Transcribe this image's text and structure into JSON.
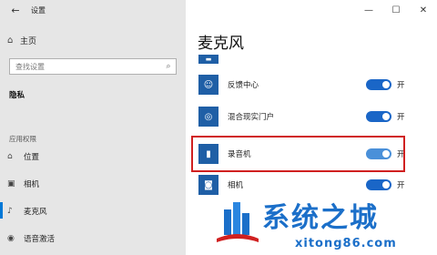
{
  "window": {
    "title": "设置",
    "back_icon": "back-arrow-icon"
  },
  "nav": {
    "home_label": "主页",
    "search_placeholder": "查找设置",
    "section_privacy": "隐私",
    "section_permissions": "应用权限",
    "items": [
      {
        "label": "位置",
        "icon": "location-icon"
      },
      {
        "label": "相机",
        "icon": "camera-icon"
      },
      {
        "label": "麦克风",
        "icon": "microphone-icon",
        "active": true
      },
      {
        "label": "语音激活",
        "icon": "voice-activation-icon"
      }
    ]
  },
  "main": {
    "title": "麦克风",
    "apps": [
      {
        "name": "反馈中心",
        "state": "开",
        "on": true
      },
      {
        "name": "混合现实门户",
        "state": "开",
        "on": true
      },
      {
        "name": "录音机",
        "state": "开",
        "on": true
      },
      {
        "name": "相机",
        "state": "开",
        "on": true
      }
    ]
  },
  "colors": {
    "accent": "#0078d7",
    "toggle_on": "#1a66c7",
    "highlight": "#d02020",
    "watermark": "#1b6fc9"
  },
  "watermark": {
    "text": "系统之城",
    "url": "xitong86.com"
  }
}
